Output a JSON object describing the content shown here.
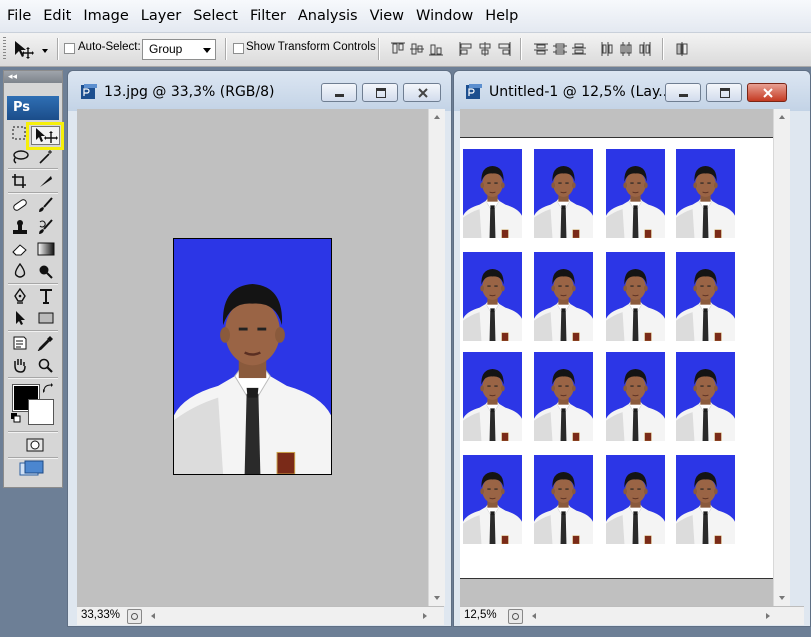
{
  "menu": [
    "File",
    "Edit",
    "Image",
    "Layer",
    "Select",
    "Filter",
    "Analysis",
    "View",
    "Window",
    "Help"
  ],
  "options_bar": {
    "auto_select_label": "Auto-Select:",
    "auto_select_checked": false,
    "group_value": "Group",
    "show_transform_label": "Show Transform Controls",
    "show_transform_checked": false
  },
  "tools": {
    "dock_label": "◂◂",
    "logo": "Ps",
    "active_tool": "move-tool",
    "foreground_color": "#000000",
    "background_color": "#ffffff"
  },
  "windows": [
    {
      "title": "13.jpg @ 33,3% (RGB/8)",
      "zoom": "33,33%",
      "active": false,
      "photos": 1
    },
    {
      "title": "Untitled-1 @ 12,5% (Lay...",
      "zoom": "12,5%",
      "active": true,
      "photos": 16,
      "grid": {
        "rows": 4,
        "cols": 4
      }
    }
  ],
  "colors": {
    "photo_background": "#2c36e6",
    "highlight": "#f6ef0a",
    "close_active": "#c43a22"
  }
}
